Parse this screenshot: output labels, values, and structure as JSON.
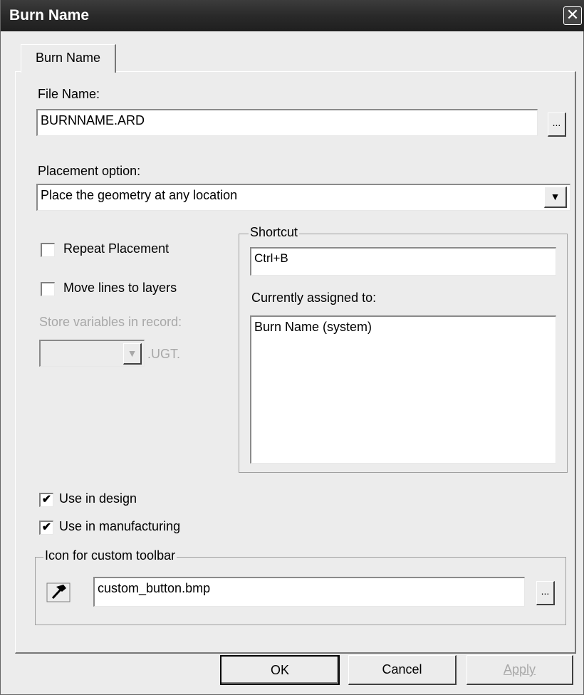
{
  "window": {
    "title": "Burn Name",
    "close_glyph": "✕"
  },
  "tab": {
    "label": "Burn Name"
  },
  "file": {
    "label": "File Name:",
    "value": "BURNNAME.ARD",
    "browse_label": "..."
  },
  "placement": {
    "label": "Placement option:",
    "selected": "Place the geometry at any location",
    "arrow_glyph": "▼"
  },
  "options": {
    "repeat_placement": {
      "label": "Repeat Placement",
      "checked": false
    },
    "move_lines": {
      "label": "Move lines to layers",
      "checked": false
    },
    "store_variables": {
      "label": "Store variables in record:",
      "value": "",
      "suffix": ".UGT.",
      "arrow_glyph": "▼"
    }
  },
  "shortcut": {
    "group_label": "Shortcut",
    "value": "Ctrl+B",
    "assigned_label": "Currently assigned to:",
    "assigned_value": "Burn Name (system)"
  },
  "usage": {
    "design": {
      "label": "Use in design",
      "checked": true,
      "check_glyph": "✔"
    },
    "manufacturing": {
      "label": "Use in manufacturing",
      "checked": true,
      "check_glyph": "✔"
    }
  },
  "icon_group": {
    "label": "Icon for custom toolbar",
    "icon": "hammer-icon",
    "value": "custom_button.bmp",
    "browse_label": "..."
  },
  "buttons": {
    "ok": "OK",
    "cancel": "Cancel",
    "apply": "Apply"
  }
}
